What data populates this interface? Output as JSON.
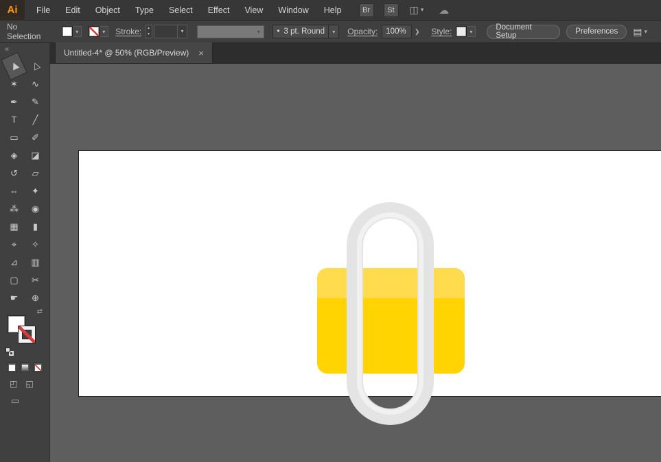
{
  "colors": {
    "canvas_bg": "#5e5e5e",
    "artboard": "#ffffff",
    "lock_body": "#ffd400",
    "lock_body_top": "#ffdb4d",
    "shackle": "#e4e4e4",
    "shackle_highlight": "#f3f3f3",
    "logo_orange": "#ff9a00",
    "none_red": "#d93a3a"
  },
  "menubar": {
    "logo": "Ai",
    "items": [
      "File",
      "Edit",
      "Object",
      "Type",
      "Select",
      "Effect",
      "View",
      "Window",
      "Help"
    ],
    "bridge_label": "Br",
    "stock_label": "St"
  },
  "control_bar": {
    "selection_status": "No Selection",
    "stroke_label": "Stroke:",
    "brush_value": "3 pt. Round",
    "opacity_label": "Opacity:",
    "opacity_value": "100%",
    "style_label": "Style:",
    "document_setup_label": "Document Setup",
    "preferences_label": "Preferences"
  },
  "tab_bar": {
    "title": "Untitled-4* @ 50% (RGB/Preview)"
  },
  "icons": {
    "caret_down": "▾",
    "caret_up": "▴",
    "chevron_right": "❯",
    "swap": "⇄",
    "close": "×",
    "collapse": "«",
    "bullet": "•",
    "workspace": "◫",
    "cloud": "☁",
    "panel_list": "▤",
    "draw_normal": "◰",
    "draw_behind": "◱",
    "screen_mode": "▭"
  },
  "tool_panel": {
    "tools": [
      {
        "name": "selection-tool",
        "glyph": "▶"
      },
      {
        "name": "direct-selection-tool",
        "glyph": "▷"
      },
      {
        "name": "magic-wand-tool",
        "glyph": "✶"
      },
      {
        "name": "lasso-tool",
        "glyph": "∿"
      },
      {
        "name": "pen-tool",
        "glyph": "✒"
      },
      {
        "name": "curvature-tool",
        "glyph": "✎"
      },
      {
        "name": "type-tool",
        "glyph": "T"
      },
      {
        "name": "line-segment-tool",
        "glyph": "╱"
      },
      {
        "name": "rectangle-tool",
        "glyph": "▭"
      },
      {
        "name": "paintbrush-tool",
        "glyph": "✐"
      },
      {
        "name": "shape-builder-tool",
        "glyph": "◈"
      },
      {
        "name": "eraser-tool",
        "glyph": "◪"
      },
      {
        "name": "rotate-tool",
        "glyph": "↺"
      },
      {
        "name": "scale-tool",
        "glyph": "▱"
      },
      {
        "name": "width-tool",
        "glyph": "⇔"
      },
      {
        "name": "free-transform-tool",
        "glyph": "✦"
      },
      {
        "name": "symbol-sprayer-tool",
        "glyph": "⁂"
      },
      {
        "name": "blend-tool",
        "glyph": "◉"
      },
      {
        "name": "mesh-tool",
        "glyph": "▦"
      },
      {
        "name": "gradient-tool",
        "glyph": "▮"
      },
      {
        "name": "eyedropper-tool",
        "glyph": "⌖"
      },
      {
        "name": "shaper-tool",
        "glyph": "✧"
      },
      {
        "name": "perspective-grid-tool",
        "glyph": "⊿"
      },
      {
        "name": "column-graph-tool",
        "glyph": "▥"
      },
      {
        "name": "artboard-tool",
        "glyph": "▢"
      },
      {
        "name": "slice-tool",
        "glyph": "✂"
      },
      {
        "name": "hand-tool",
        "glyph": "☛"
      },
      {
        "name": "zoom-tool",
        "glyph": "⊕"
      }
    ]
  }
}
